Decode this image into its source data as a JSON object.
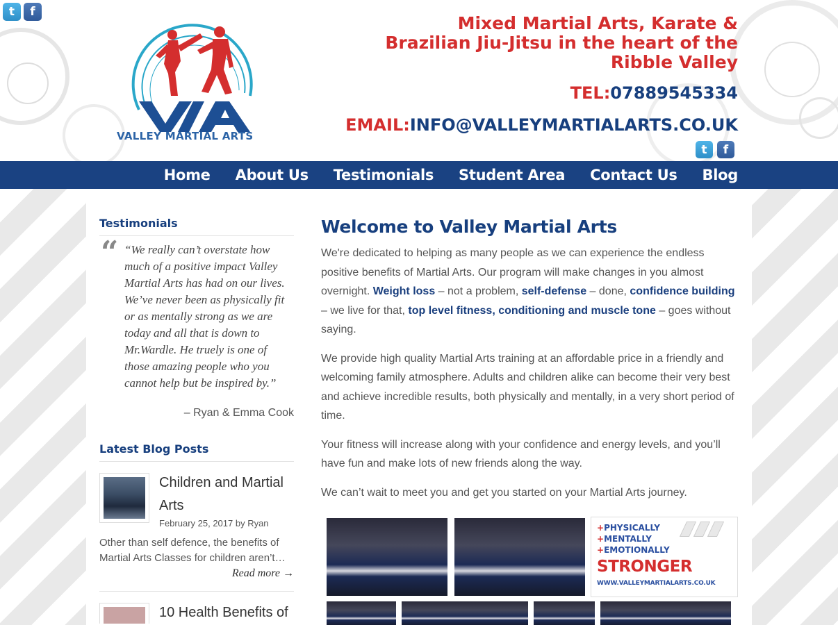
{
  "header": {
    "logo_text": "VALLEY MARTIAL ARTS",
    "tagline": "Mixed Martial Arts, Karate & Brazilian Jiu-Jitsu in the heart of the Ribble Valley",
    "tel_label": "TEL:",
    "tel_value": "07889545334",
    "email_label": "EMAIL:",
    "email_value": "INFO@VALLEYMARTIALARTS.CO.UK",
    "social": {
      "twitter_glyph": "t",
      "facebook_glyph": "f"
    }
  },
  "nav": {
    "items": [
      {
        "label": "Home"
      },
      {
        "label": "About Us"
      },
      {
        "label": "Testimonials"
      },
      {
        "label": "Student Area"
      },
      {
        "label": "Contact Us"
      },
      {
        "label": "Blog"
      }
    ]
  },
  "sidebar": {
    "testimonials_title": "Testimonials",
    "quote_mark": "“",
    "quote": "“We really can’t overstate how much of a positive impact Valley Martial Arts has had on our lives. We’ve never been as physically fit or as mentally strong as we are today and all that is down to Mr.Wardle. He truely is one of those amazing people who you cannot help but be inspired by.”",
    "quote_author": "– Ryan & Emma Cook",
    "blog_title": "Latest Blog Posts",
    "posts": [
      {
        "title": "Children and Martial Arts",
        "meta": "February 25, 2017 by Ryan",
        "excerpt": "Other than self defence, the benefits of Martial Arts Classes for children aren’t…",
        "read_more": "Read more →"
      },
      {
        "title": "10 Health Benefits of"
      }
    ]
  },
  "main": {
    "title": "Welcome to Valley Martial Arts",
    "p1": {
      "t1": "We're dedicated to helping as many people as we can experience the endless positive benefits of Martial Arts. Our program will make changes in you almost overnight. ",
      "k1": "Weight loss",
      "t2": " – not a problem, ",
      "k2": "self-defense",
      "t3": " – done, ",
      "k3": "confidence building",
      "t4": " – we live for that, ",
      "k4": "top level fitness, conditioning and muscle tone",
      "t5": " – goes without saying."
    },
    "p2": "We provide high quality Martial Arts training at an affordable price in a friendly and welcoming family atmosphere. Adults and children alike can become their very best and achieve incredible results, both physically and mentally, in a very short period of time.",
    "p3": "Your fitness will increase along with your confidence and energy levels, and you’ll have fun and make lots of new friends along the way.",
    "p4": "We can’t wait to meet you and get you started on your Martial Arts journey.",
    "promo": {
      "line1": "PHYSICALLY",
      "line2": "MENTALLY",
      "line3": "EMOTIONALLY",
      "plus": "+",
      "headline": "STRONGER",
      "url": "WWW.VALLEYMARTIALARTS.CO.UK"
    }
  },
  "colors": {
    "brand_blue": "#173f7e",
    "nav_blue": "#1a4282",
    "brand_red": "#d42e2e",
    "logo_cyan": "#2aa7c9"
  }
}
